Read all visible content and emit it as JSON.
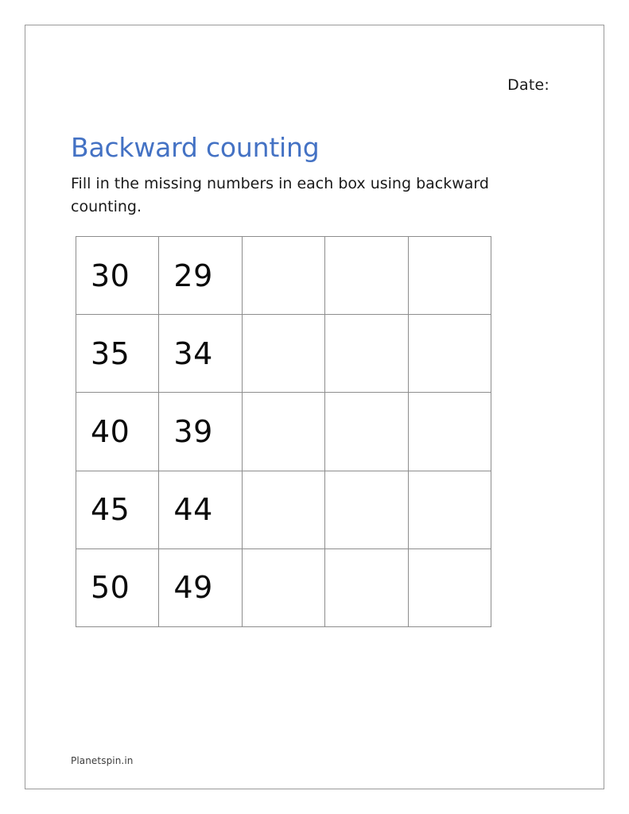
{
  "page": {
    "date_label": "Date:",
    "title": "Backward counting",
    "instructions": "Fill in the missing numbers in each box using backward counting.",
    "footer": "Planetspin.in",
    "title_color": "#4472c4",
    "text_color": "#1a1a1a",
    "grid_line_color": "#8d8d8d",
    "page_border_color": "#9a9a9a"
  },
  "grid": {
    "rows": 5,
    "columns": 5,
    "cells": [
      [
        "30",
        "29",
        "",
        "",
        ""
      ],
      [
        "35",
        "34",
        "",
        "",
        ""
      ],
      [
        "40",
        "39",
        "",
        "",
        ""
      ],
      [
        "45",
        "44",
        "",
        "",
        ""
      ],
      [
        "50",
        "49",
        "",
        "",
        ""
      ]
    ]
  }
}
